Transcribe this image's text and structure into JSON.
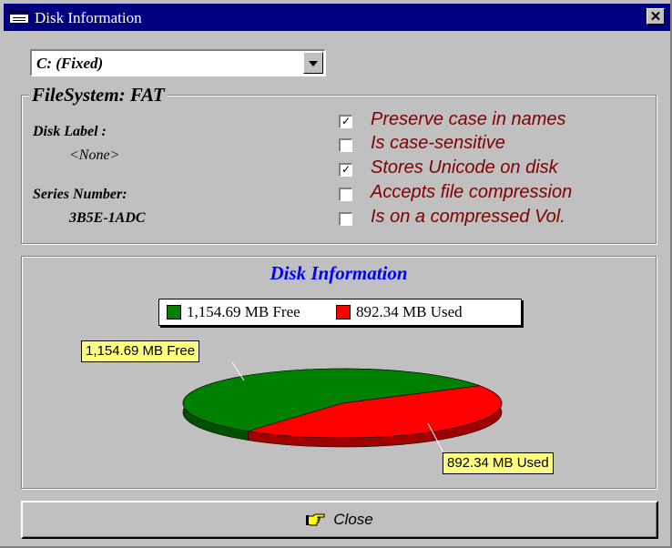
{
  "window": {
    "title": "Disk Information",
    "close_glyph": "✕"
  },
  "drive_select": {
    "value": "C: (Fixed)"
  },
  "filesystem": {
    "legend": "FileSystem: FAT",
    "disk_label_caption": "Disk Label :",
    "disk_label_value": "<None>",
    "serial_caption": "Series Number:",
    "serial_value": "3B5E-1ADC",
    "flags": [
      {
        "label": "Preserve case in names",
        "checked": true
      },
      {
        "label": "Is case-sensitive",
        "checked": false
      },
      {
        "label": "Stores Unicode on disk",
        "checked": true
      },
      {
        "label": "Accepts file compression",
        "checked": false
      },
      {
        "label": "Is on a compressed Vol.",
        "checked": false
      }
    ]
  },
  "chart_data": {
    "type": "pie",
    "title": "Disk Information",
    "slices": [
      {
        "label": "1,154.69 MB Free",
        "value": 1154.69,
        "color": "#008000"
      },
      {
        "label": "892.34 MB Used",
        "value": 892.34,
        "color": "#ff0000"
      }
    ],
    "legend": "top"
  },
  "close_button": {
    "label": "Close",
    "icon": "pointing-hand-icon"
  }
}
